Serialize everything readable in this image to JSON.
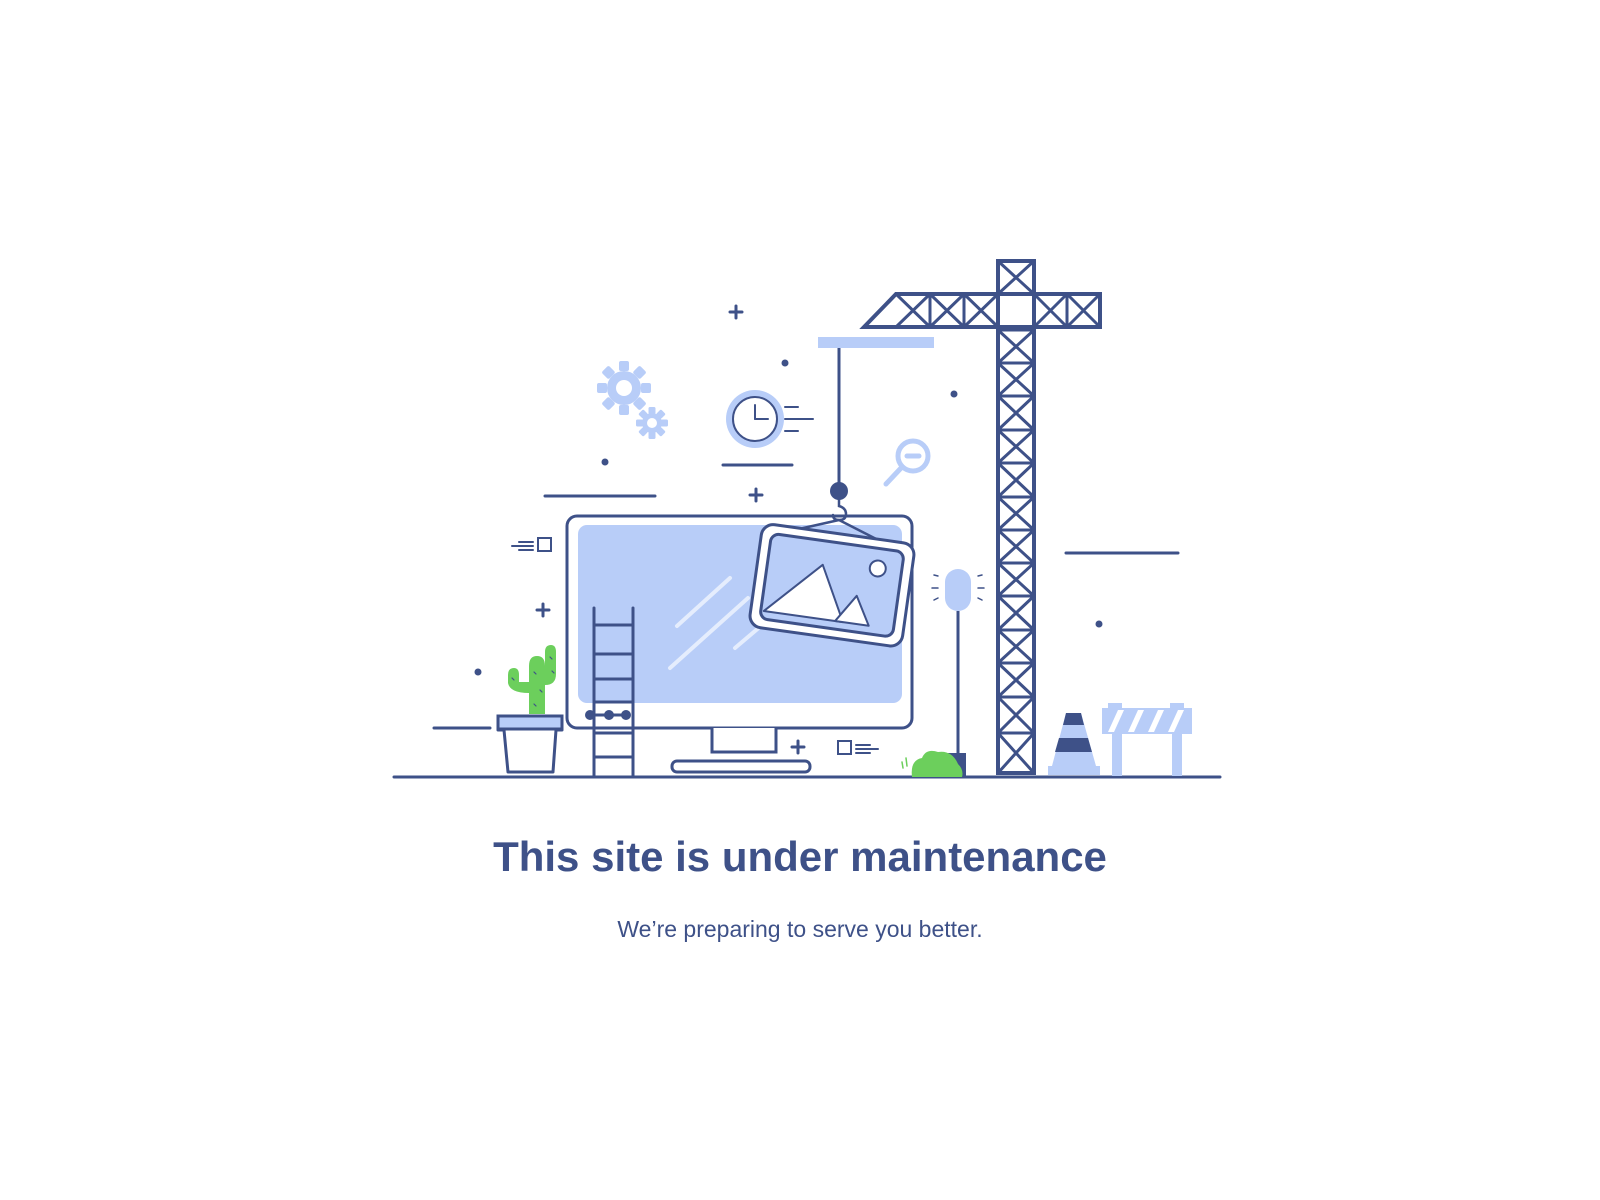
{
  "page": {
    "title": "This site is under maintenance",
    "subtitle": "We’re preparing to serve you better."
  },
  "illustration": {
    "icons": [
      "gears-icon",
      "clock-icon",
      "magnifier-icon",
      "crane-icon",
      "monitor-icon",
      "image-frame-icon",
      "ladder-icon",
      "cactus-icon",
      "traffic-cone-icon",
      "barrier-icon",
      "lamp-icon",
      "bush-icon"
    ]
  },
  "colors": {
    "primary": "#3e5188",
    "light_blue": "#b8cdf8",
    "green": "#6ccf5c",
    "background": "#ffffff"
  }
}
